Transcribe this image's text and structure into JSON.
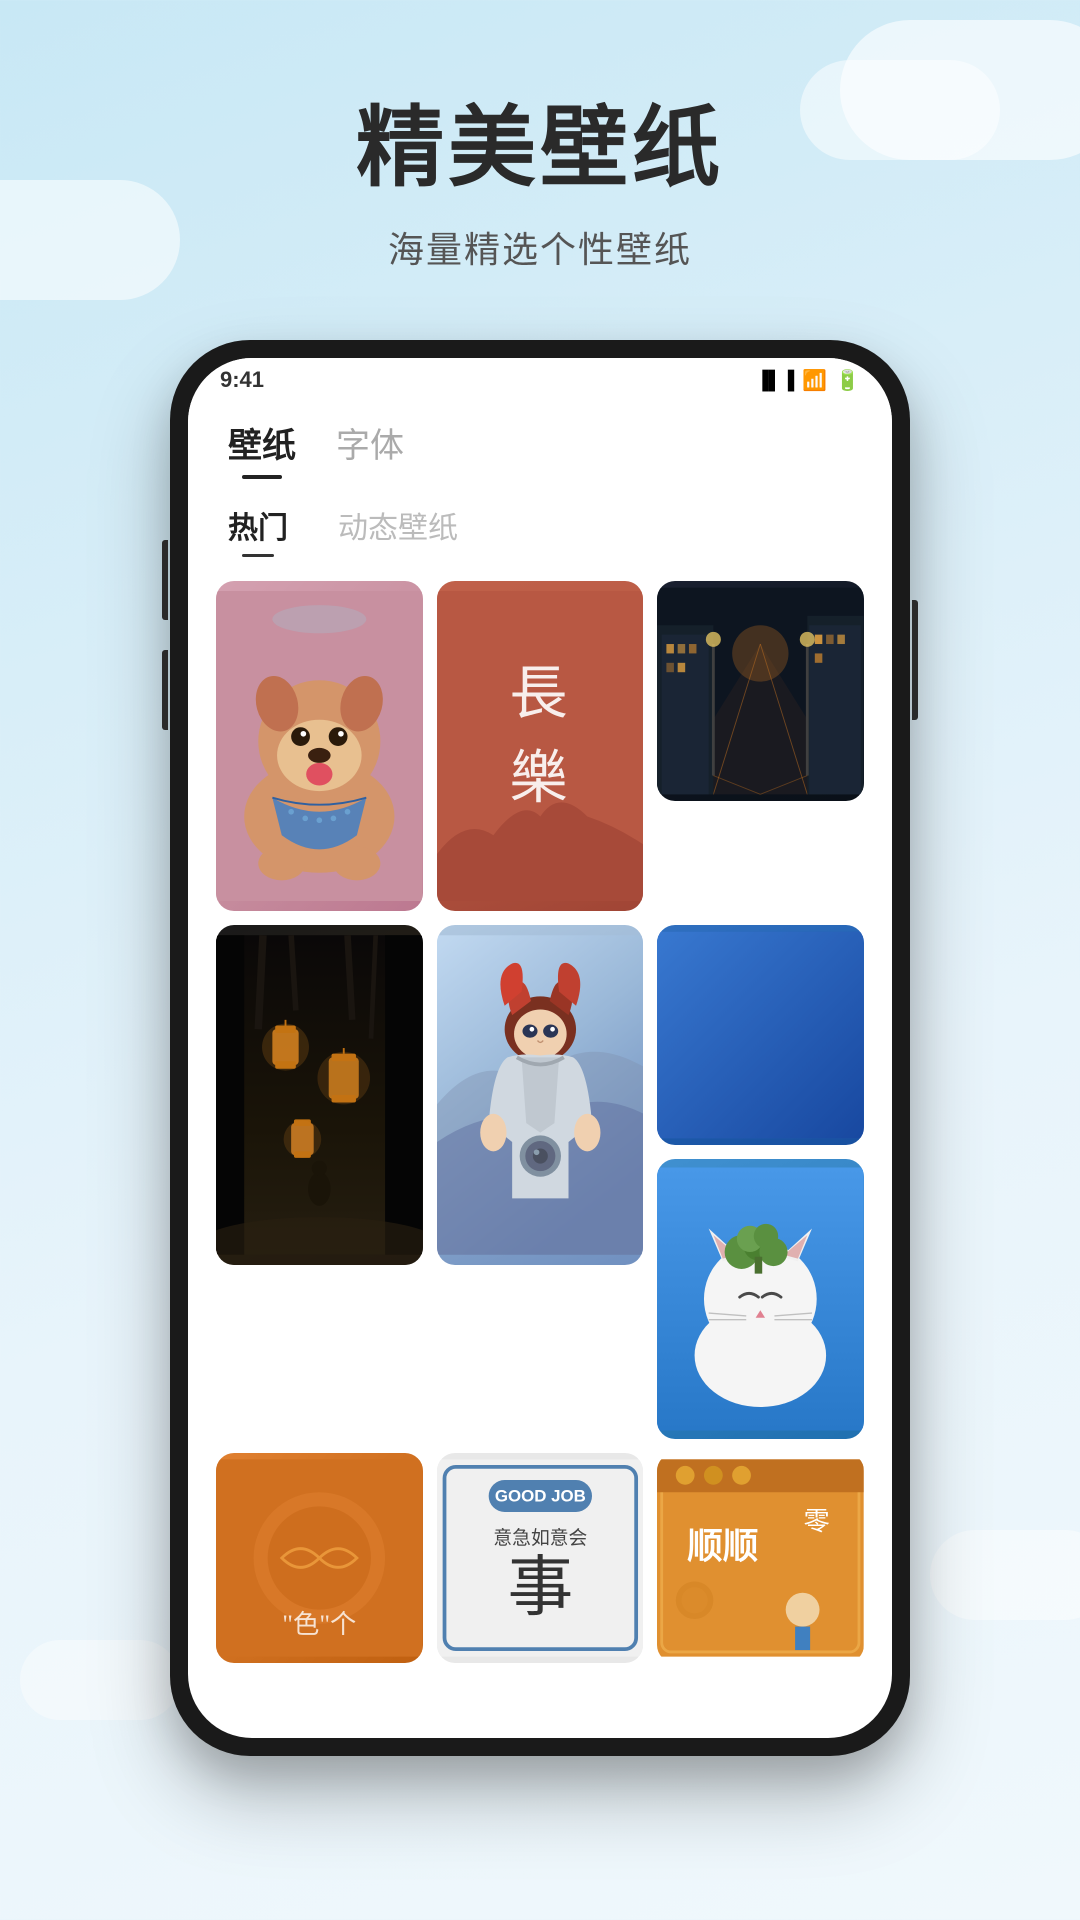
{
  "header": {
    "title": "精美壁纸",
    "subtitle": "海量精选个性壁纸"
  },
  "app": {
    "nav_tabs": [
      {
        "label": "壁纸",
        "active": true
      },
      {
        "label": "字体",
        "active": false
      }
    ],
    "sub_tabs": [
      {
        "label": "热门",
        "active": true
      },
      {
        "label": "动态壁纸",
        "active": false
      }
    ]
  },
  "wallpapers": {
    "items": [
      {
        "id": "dog",
        "type": "dog",
        "desc": "柴犬壁纸"
      },
      {
        "id": "chinese-long-le",
        "type": "chinese",
        "text": "長\n樂",
        "desc": "长乐文字壁纸"
      },
      {
        "id": "street-night",
        "type": "street",
        "desc": "夜晚街道壁纸"
      },
      {
        "id": "dark-forest",
        "type": "dark-forest",
        "desc": "暗黑森林壁纸"
      },
      {
        "id": "anime-warrior",
        "type": "anime",
        "desc": "动漫战士壁纸"
      },
      {
        "id": "blue-solid",
        "type": "blue",
        "desc": "纯蓝壁纸"
      },
      {
        "id": "cat-vegetable",
        "type": "cat",
        "desc": "猫咪壁纸"
      },
      {
        "id": "spiral",
        "type": "spiral",
        "desc": "螺旋壁纸"
      },
      {
        "id": "goodjob",
        "type": "goodjob",
        "badge": "GOOD JOB",
        "chinese1": "意急如意会",
        "chinese2": "事",
        "desc": "励志壁纸"
      },
      {
        "id": "chinese2",
        "type": "chinese2",
        "text": "顺顺 零",
        "desc": "顺顺壁纸"
      }
    ]
  },
  "colors": {
    "bg_start": "#c8e8f5",
    "bg_end": "#e8f4fb",
    "title_color": "#2a2a2a",
    "subtitle_color": "#555555",
    "nav_active": "#222222",
    "nav_inactive": "#aaaaaa"
  }
}
